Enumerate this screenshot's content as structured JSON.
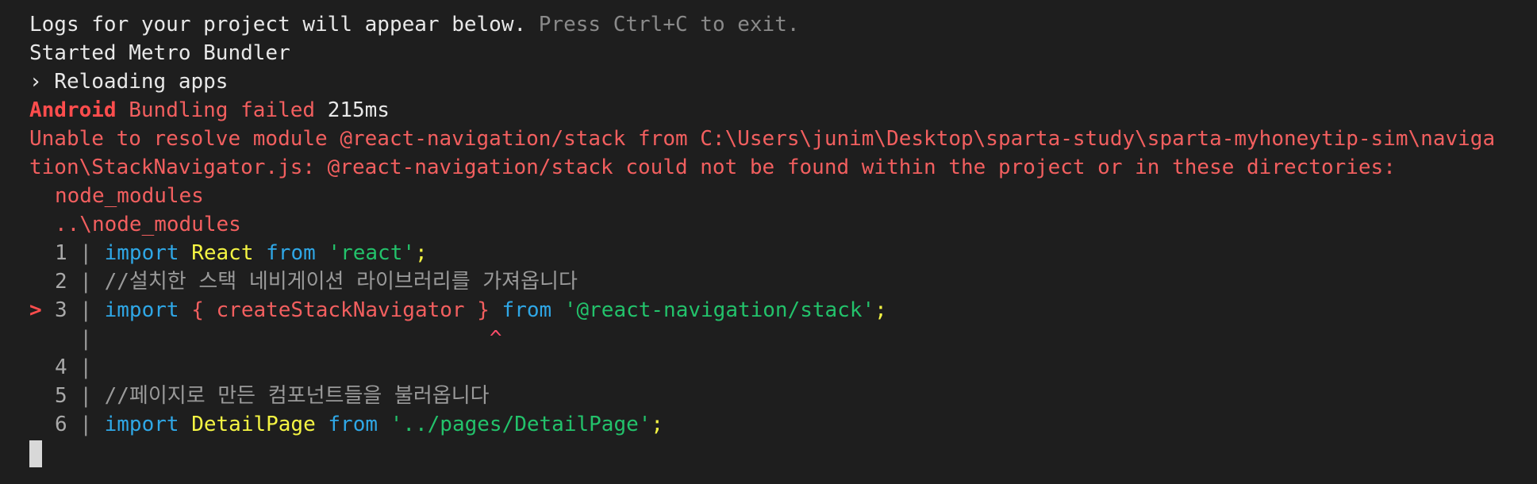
{
  "log_header": {
    "main": "Logs for your project will appear below.",
    "hint": " Press Ctrl+C to exit."
  },
  "started": "Started Metro Bundler",
  "reloading": "› Reloading apps",
  "bundling": {
    "platform": "Android",
    "message": " Bundling failed ",
    "duration": "215ms"
  },
  "error": {
    "line1": "Unable to resolve module @react-navigation/stack from C:\\Users\\junim\\Desktop\\sparta-study\\sparta-myhoneytip-sim\\naviga",
    "line2": "tion\\StackNavigator.js: @react-navigation/stack could not be found within the project or in these directories:",
    "dir1": "node_modules",
    "dir2": "..\\node_modules"
  },
  "code": {
    "l1": {
      "num": "1",
      "kw1": "import",
      "ident": "React",
      "kw2": "from",
      "str": "'react'",
      "semi": ";"
    },
    "l2": {
      "num": "2",
      "comment": "//설치한 스택 네비게이션 라이브러리를 가져옵니다"
    },
    "l3": {
      "marker": ">",
      "num": "3",
      "kw1": "import",
      "brace": "{ createStackNavigator }",
      "kw2": "from",
      "str": "'@react-navigation/stack'",
      "semi": ";"
    },
    "caret": "^",
    "l4": {
      "num": "4"
    },
    "l5": {
      "num": "5",
      "comment": "//페이지로 만든 컴포넌트들을 불러옵니다"
    },
    "l6": {
      "num": "6",
      "kw1": "import",
      "ident": "DetailPage",
      "kw2": "from",
      "str": "'../pages/DetailPage'",
      "semi": ";"
    }
  },
  "separator": "|"
}
